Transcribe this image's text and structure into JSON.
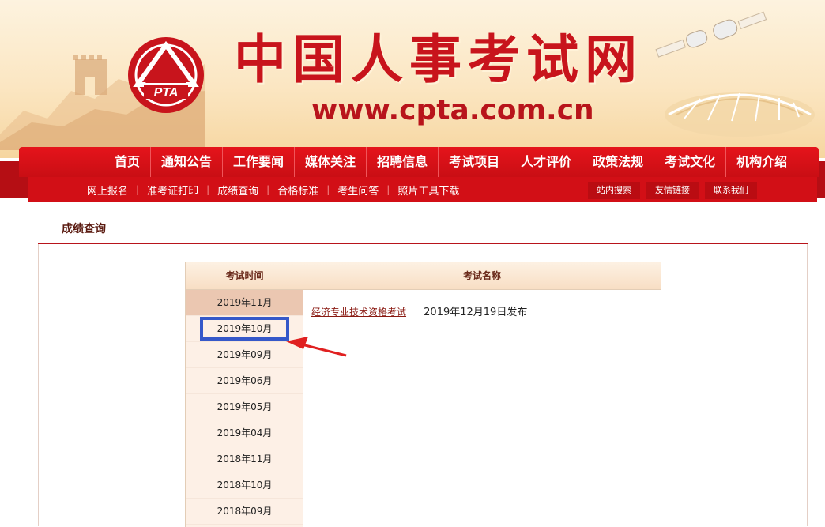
{
  "header": {
    "site_title": "中国人事考试网",
    "site_url": "www.cpta.com.cn",
    "logo_text": "PTA"
  },
  "nav": {
    "items": [
      {
        "label": "首页"
      },
      {
        "label": "通知公告"
      },
      {
        "label": "工作要闻"
      },
      {
        "label": "媒体关注"
      },
      {
        "label": "招聘信息"
      },
      {
        "label": "考试项目"
      },
      {
        "label": "人才评价"
      },
      {
        "label": "政策法规"
      },
      {
        "label": "考试文化"
      },
      {
        "label": "机构介绍"
      }
    ]
  },
  "subnav": {
    "items": [
      {
        "label": "网上报名"
      },
      {
        "label": "准考证打印"
      },
      {
        "label": "成绩查询"
      },
      {
        "label": "合格标准"
      },
      {
        "label": "考生问答"
      },
      {
        "label": "照片工具下载"
      }
    ],
    "buttons": [
      {
        "label": "站内搜索"
      },
      {
        "label": "友情链接"
      },
      {
        "label": "联系我们"
      }
    ]
  },
  "page": {
    "heading": "成绩查询"
  },
  "table": {
    "col_date_header": "考试时间",
    "col_name_header": "考试名称",
    "dates": [
      {
        "label": "2019年11月"
      },
      {
        "label": "2019年10月"
      },
      {
        "label": "2019年09月"
      },
      {
        "label": "2019年06月"
      },
      {
        "label": "2019年05月"
      },
      {
        "label": "2019年04月"
      },
      {
        "label": "2018年11月"
      },
      {
        "label": "2018年10月"
      },
      {
        "label": "2018年09月"
      }
    ],
    "exams": [
      {
        "name": "经济专业技术资格考试",
        "published": "2019年12月19日发布"
      }
    ]
  },
  "colors": {
    "brand_red": "#c8141c",
    "annotation_blue": "#3558c9",
    "annotation_red": "#e02020"
  }
}
